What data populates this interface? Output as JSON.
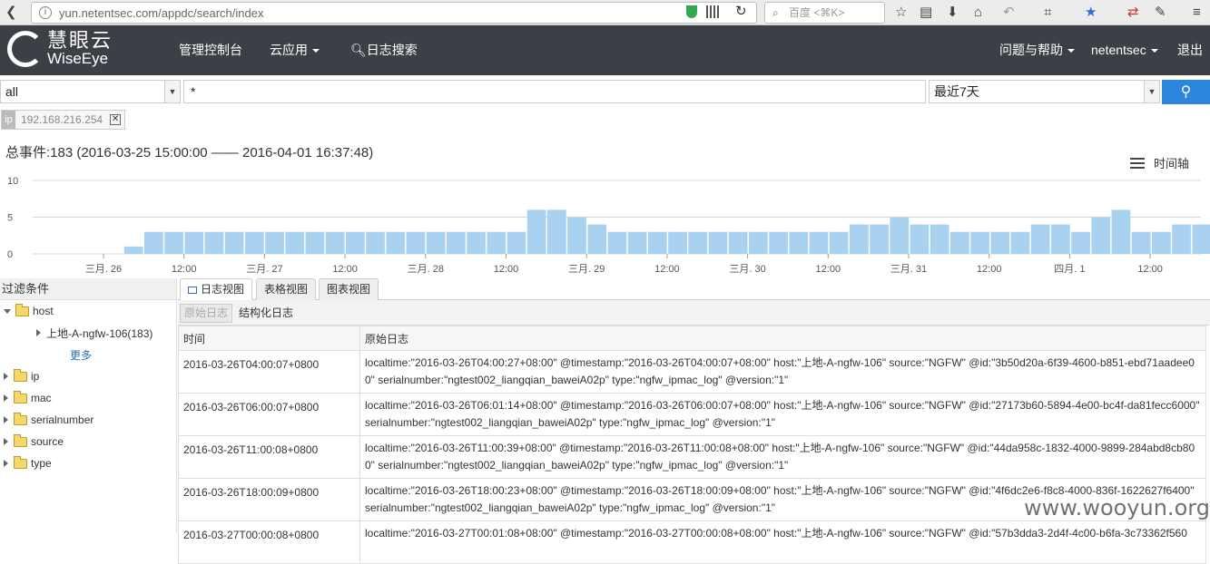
{
  "browser": {
    "url_domain": "yun.",
    "url_host": "netentsec",
    "url_rest": ".com/appdc/search/index",
    "url_prefix": "yun.netentsec.com/appdc/search/index",
    "search_placeholder": "百度 <⌘K>"
  },
  "nav": {
    "brand_cn": "慧眼云",
    "brand_en": "WiseEye",
    "console": "管理控制台",
    "cloud_app": "云应用",
    "log_search": "日志搜索",
    "help": "问题与帮助",
    "user": "netentsec",
    "logout": "退出"
  },
  "search": {
    "scope": "all",
    "query": "*",
    "time_range": "最近7天"
  },
  "filter_tag": {
    "key": "ip",
    "value": "192.168.216.254"
  },
  "summary": "总事件:183 (2016-03-25 15:00:00 —— 2016-04-01 16:37:48)",
  "timeline_label": "时间轴",
  "chart_data": {
    "type": "bar",
    "ylim": [
      0,
      10
    ],
    "yticks": [
      "10",
      "5",
      "0"
    ],
    "values": [
      0,
      0,
      0,
      0,
      1,
      3,
      3,
      3,
      3,
      3,
      3,
      3,
      3,
      3,
      3,
      3,
      3,
      3,
      3,
      3,
      3,
      3,
      3,
      3,
      6,
      6,
      5,
      4,
      3,
      3,
      3,
      3,
      3,
      3,
      3,
      3,
      3,
      3,
      3,
      3,
      4,
      4,
      5,
      4,
      4,
      3,
      3,
      3,
      3,
      4,
      4,
      3,
      5,
      6,
      3,
      3,
      4,
      4,
      2
    ],
    "xticks": [
      "三月. 26",
      "12:00",
      "三月. 27",
      "12:00",
      "三月. 28",
      "12:00",
      "三月. 29",
      "12:00",
      "三月. 30",
      "12:00",
      "三月. 31",
      "12:00",
      "四月. 1",
      "12:00"
    ]
  },
  "sidebar": {
    "title": "过滤条件",
    "host": "host",
    "host_child": "上地-A-ngfw-106(183)",
    "more": "更多",
    "fields": [
      "ip",
      "mac",
      "serialnumber",
      "source",
      "type"
    ]
  },
  "tabs": {
    "log_view": "日志视图",
    "table_view": "表格视图",
    "chart_view": "图表视图"
  },
  "subbar": {
    "raw": "原始日志",
    "structured": "结构化日志"
  },
  "table": {
    "col_time": "时间",
    "col_raw": "原始日志",
    "rows": [
      {
        "time": "2016-03-26T04:00:07+0800",
        "raw": "localtime:\"2016-03-26T04:00:27+08:00\"  @timestamp:\"2016-03-26T04:00:07+08:00\"  host:\"上地-A-ngfw-106\"  source:\"NGFW\"  @id:\"3b50d20a-6f39-4600-b851-ebd71aadee00\"  serialnumber:\"ngtest002_liangqian_baweiA02p\"  type:\"ngfw_ipmac_log\"  @version:\"1\""
      },
      {
        "time": "2016-03-26T06:00:07+0800",
        "raw": "localtime:\"2016-03-26T06:01:14+08:00\"  @timestamp:\"2016-03-26T06:00:07+08:00\"  host:\"上地-A-ngfw-106\"  source:\"NGFW\"  @id:\"27173b60-5894-4e00-bc4f-da81fecc6000\"  serialnumber:\"ngtest002_liangqian_baweiA02p\"  type:\"ngfw_ipmac_log\"  @version:\"1\""
      },
      {
        "time": "2016-03-26T11:00:08+0800",
        "raw": "localtime:\"2016-03-26T11:00:39+08:00\"  @timestamp:\"2016-03-26T11:00:08+08:00\"  host:\"上地-A-ngfw-106\"  source:\"NGFW\"  @id:\"44da958c-1832-4000-9899-284abd8cb800\"  serialnumber:\"ngtest002_liangqian_baweiA02p\"  type:\"ngfw_ipmac_log\"  @version:\"1\""
      },
      {
        "time": "2016-03-26T18:00:09+0800",
        "raw": "localtime:\"2016-03-26T18:00:23+08:00\"  @timestamp:\"2016-03-26T18:00:09+08:00\"  host:\"上地-A-ngfw-106\"  source:\"NGFW\"  @id:\"4f6dc2e6-f8c8-4000-836f-1622627f6400\"  serialnumber:\"ngtest002_liangqian_baweiA02p\"  type:\"ngfw_ipmac_log\"  @version:\"1\""
      },
      {
        "time": "2016-03-27T00:00:08+0800",
        "raw": "localtime:\"2016-03-27T00:01:08+08:00\"  @timestamp:\"2016-03-27T00:00:08+08:00\"  host:\"上地-A-ngfw-106\"  source:\"NGFW\"  @id:\"57b3dda3-2d4f-4c00-b6fa-3c73362f560"
      }
    ]
  },
  "watermark": "www.wooyun.org"
}
